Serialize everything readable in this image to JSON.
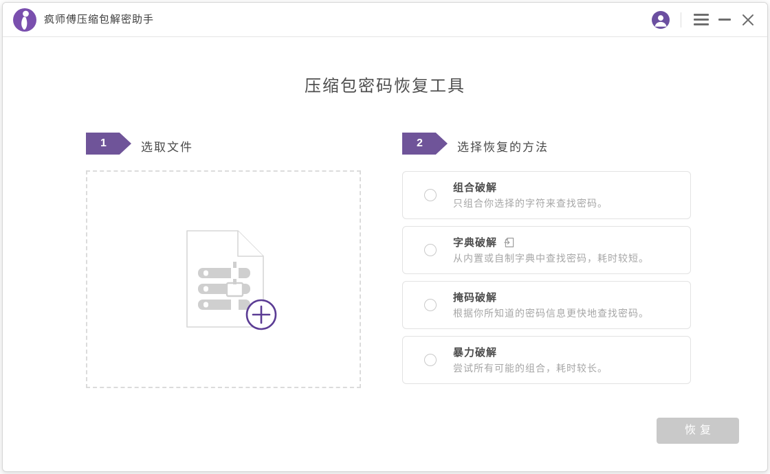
{
  "titlebar": {
    "app_title": "疯师傅压缩包解密助手",
    "icons": {
      "logo": "brand-logo-icon",
      "account": "user-account-icon",
      "menu": "hamburger-menu-icon",
      "minimize": "minimize-icon",
      "close": "close-icon"
    }
  },
  "page": {
    "title": "压缩包密码恢复工具"
  },
  "steps": [
    {
      "number": "1",
      "label": "选取文件"
    },
    {
      "number": "2",
      "label": "选择恢复的方法"
    }
  ],
  "dropzone": {
    "icons": {
      "file": "archive-file-icon",
      "add": "plus-icon"
    }
  },
  "methods": [
    {
      "title": "组合破解",
      "desc": "只组合你选择的字符来查找密码。"
    },
    {
      "title": "字典破解",
      "desc": "从内置或自制字典中查找密码，耗时较短。",
      "extra_icon": "import-dictionary-icon"
    },
    {
      "title": "掩码破解",
      "desc": "根据你所知道的密码信息更快地查找密码。"
    },
    {
      "title": "暴力破解",
      "desc": "尝试所有可能的组合，耗时较长。"
    }
  ],
  "footer": {
    "recover_label": "恢复",
    "recover_enabled": false
  },
  "colors": {
    "brand_purple": "#7a4fae",
    "badge_purple": "#6f5499",
    "accent_dark_purple": "#5b3c94",
    "disabled_button": "#c9c9c9",
    "border_gray": "#e2e2e2",
    "text_dark": "#4c4c4c",
    "text_gray": "#a6a6a6"
  }
}
